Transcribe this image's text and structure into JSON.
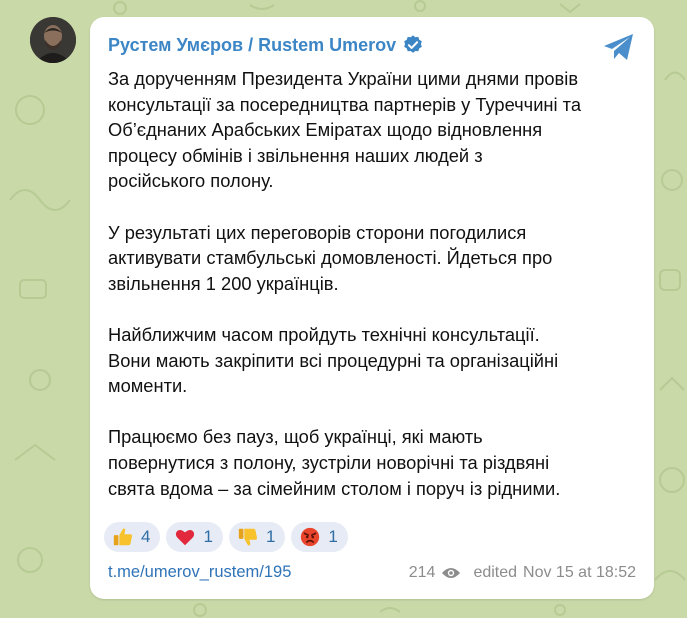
{
  "post": {
    "author": "Рустем Умєров / Rustem Umerov",
    "paragraphs": [
      [
        "За дорученням Президента України цими днями провів",
        "консультації за посередництва партнерів у Туреччині та",
        "Об’єднаних Арабських Еміратах щодо відновлення",
        "процесу обмінів і звільнення наших людей з",
        "російського полону."
      ],
      [
        "У результаті цих переговорів сторони погодилися",
        "активувати стамбульські домовленості. Йдеться про",
        "звільнення 1 200 українців."
      ],
      [
        "Найближчим часом пройдуть технічні консультації.",
        "Вони мають закріпити всі процедурні та організаційні",
        "моменти."
      ],
      [
        "Працюємо без пауз, щоб українці, які мають",
        "повернутися з полону, зустріли новорічні та різдвяні",
        "свята вдома – за сімейним столом і поруч із рідними."
      ]
    ],
    "reactions": [
      {
        "icon": "thumbs-up-icon",
        "count": "4"
      },
      {
        "icon": "heart-icon",
        "count": "1"
      },
      {
        "icon": "thumbs-down-icon",
        "count": "1"
      },
      {
        "icon": "angry-face-icon",
        "count": "1"
      }
    ],
    "link": "t.me/umerov_rustem/195",
    "views": "214",
    "edited_label": "edited",
    "timestamp": "Nov 15 at 18:52"
  },
  "colors": {
    "wallpaper": "#c9d9a8",
    "author": "#3d86c6",
    "link": "#2f73b8",
    "reaction_bg": "#e7ebf5",
    "verified": "#3d86c6"
  }
}
